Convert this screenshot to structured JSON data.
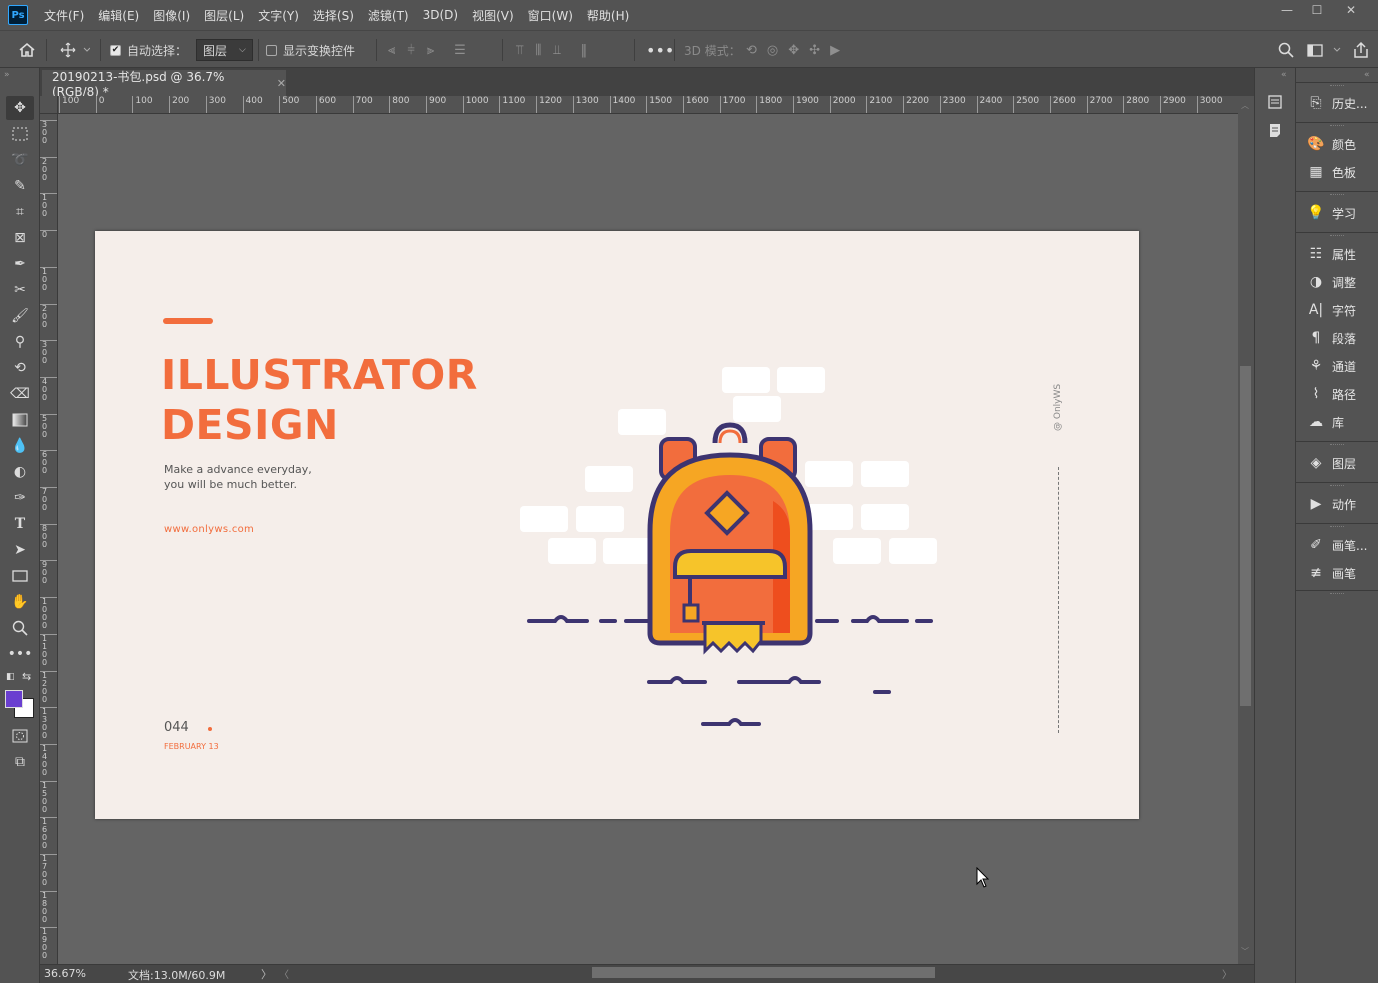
{
  "app": {
    "logo": "Ps"
  },
  "menu": [
    "文件(F)",
    "编辑(E)",
    "图像(I)",
    "图层(L)",
    "文字(Y)",
    "选择(S)",
    "滤镜(T)",
    "3D(D)",
    "视图(V)",
    "窗口(W)",
    "帮助(H)"
  ],
  "options": {
    "auto_select_label": "自动选择：",
    "auto_select_checked": true,
    "layer_select_value": "图层",
    "show_transform_label": "显示变换控件",
    "show_transform_checked": false,
    "mode_3d_label": "3D 模式："
  },
  "document": {
    "tab_title": "20190213-书包.psd @ 36.7%(RGB/8) *",
    "zoom": "36.67%",
    "doc_size": "文档:13.0M/60.9M"
  },
  "ruler_h": [
    "100",
    "0",
    "100",
    "200",
    "300",
    "400",
    "500",
    "600",
    "700",
    "800",
    "900",
    "1000",
    "1100",
    "1200",
    "1300",
    "1400",
    "1500",
    "1600",
    "1700",
    "1800",
    "1900",
    "2000",
    "2100",
    "2200",
    "2300",
    "2400",
    "2500",
    "2600",
    "2700",
    "2800",
    "2900",
    "3000"
  ],
  "ruler_v": [
    "300",
    "200",
    "100",
    "0",
    "100",
    "200",
    "300",
    "400",
    "500",
    "600",
    "700",
    "800",
    "900",
    "1000",
    "1100",
    "1200",
    "1300",
    "1400",
    "1500",
    "1600",
    "1700",
    "1800",
    "1900"
  ],
  "panels": [
    {
      "id": "history",
      "label": "历史..."
    },
    {
      "id": "color",
      "label": "颜色"
    },
    {
      "id": "swatches",
      "label": "色板"
    },
    {
      "id": "learn",
      "label": "学习"
    },
    {
      "id": "properties",
      "label": "属性"
    },
    {
      "id": "adjustments",
      "label": "调整"
    },
    {
      "id": "character",
      "label": "字符"
    },
    {
      "id": "paragraph",
      "label": "段落"
    },
    {
      "id": "channels",
      "label": "通道"
    },
    {
      "id": "paths",
      "label": "路径"
    },
    {
      "id": "libraries",
      "label": "库"
    },
    {
      "id": "layers",
      "label": "图层"
    },
    {
      "id": "actions",
      "label": "动作"
    },
    {
      "id": "brush-settings",
      "label": "画笔..."
    },
    {
      "id": "brushes",
      "label": "画笔"
    }
  ],
  "artwork": {
    "title_line1": "ILLUSTRATOR",
    "title_line2": "DESIGN",
    "tagline_line1": "Make a advance everyday,",
    "tagline_line2": "you will be much better.",
    "website": "www.onlyws.com",
    "number": "044",
    "date": "FEBRUARY 13",
    "vertical_credit": "@ OnlyWS",
    "accent_color": "#f26d3d",
    "navy_color": "#3d3470",
    "background_color": "#f5eeea"
  },
  "colors": {
    "foreground": "#6a3fd0",
    "background": "#ffffff"
  }
}
